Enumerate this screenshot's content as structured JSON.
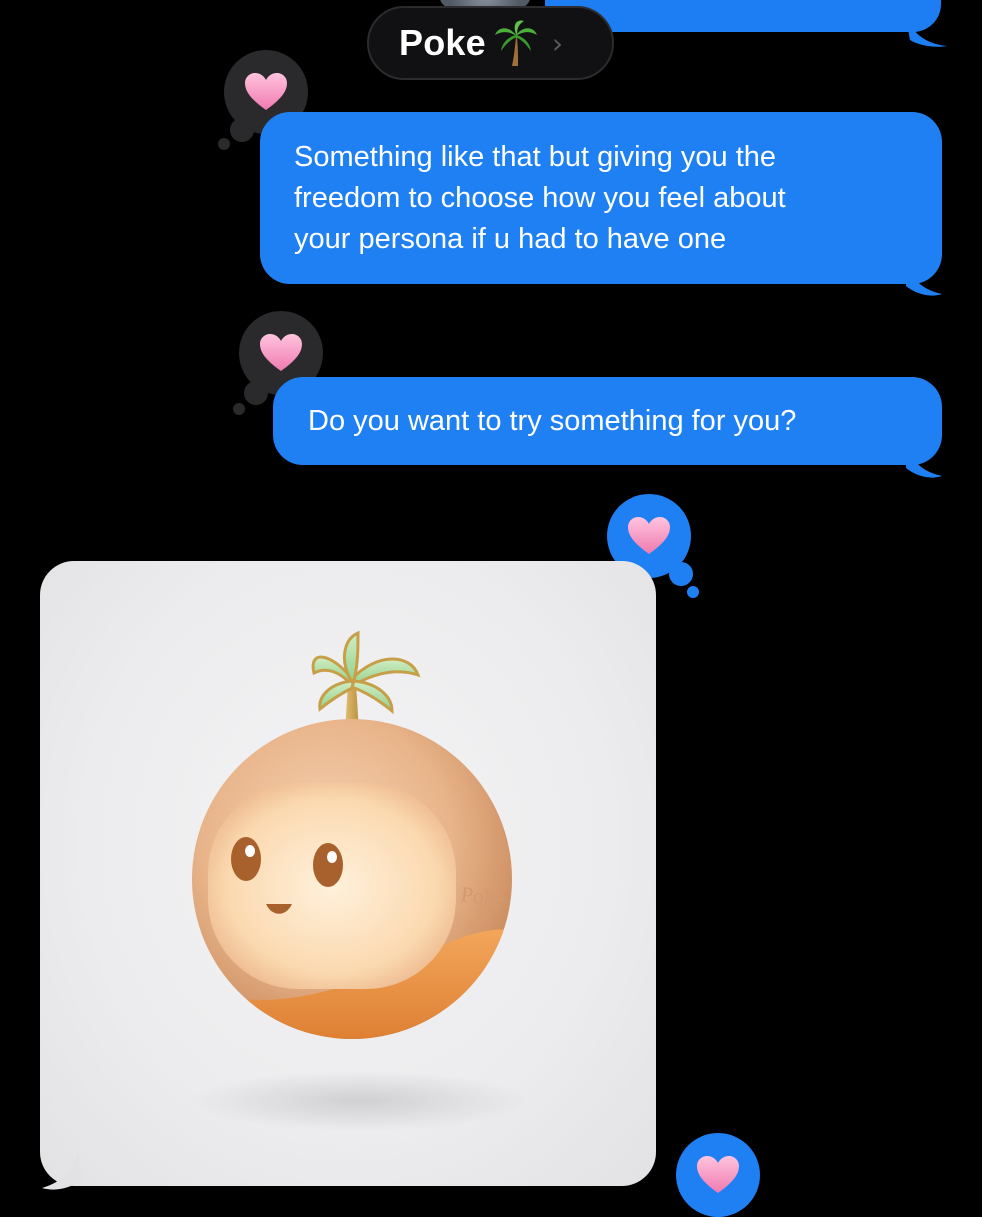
{
  "conversation": {
    "contact_name": "Poke",
    "contact_icon": "palm-tree-icon",
    "chevron_glyph": "›"
  },
  "messages": [
    {
      "type": "text",
      "sender": "me",
      "text": "Something like that but giving you the freedom to choose how you feel about your persona if u had to have one",
      "lines": [
        "Something like that but giving you the",
        "freedom to choose how you feel about",
        "your persona if u had to have one"
      ],
      "reaction": "heart-icon"
    },
    {
      "type": "text",
      "sender": "me",
      "text": "Do you want to try something for you?",
      "reaction": "heart-icon"
    },
    {
      "type": "image",
      "sender": "contact",
      "image_subject": "orange round robot mascot with palm tree on top",
      "mascot_label": "Poke",
      "reaction": "heart-icon"
    }
  ],
  "colors": {
    "background": "#000000",
    "outgoing_bubble": "#1f80f4",
    "reaction_dark": "#2a2a2c",
    "reaction_blue": "#1f80f4",
    "heart": "#f49ac2",
    "mascot_body": "#e8b48a",
    "mascot_base": "#ef9a4a"
  }
}
